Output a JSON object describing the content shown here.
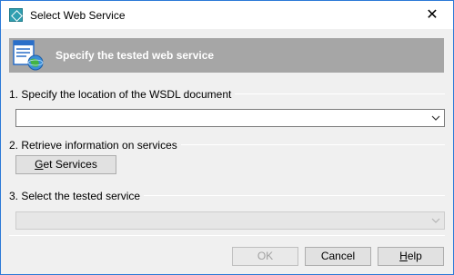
{
  "window": {
    "title": "Select Web Service",
    "close_glyph": "✕"
  },
  "banner": {
    "text": "Specify the tested web service",
    "icon": "web-service-icon"
  },
  "sections": {
    "wsdl_label": "1. Specify the location of the WSDL document",
    "wsdl_value": "",
    "retrieve_label": "2. Retrieve information on services",
    "get_services_label": "Get Services",
    "service_label": "3. Select the tested service",
    "service_value": ""
  },
  "buttons": {
    "ok": "OK",
    "cancel": "Cancel",
    "help": "Help"
  },
  "colors": {
    "banner": "#a6a6a6",
    "window_border": "#2b79d7"
  }
}
